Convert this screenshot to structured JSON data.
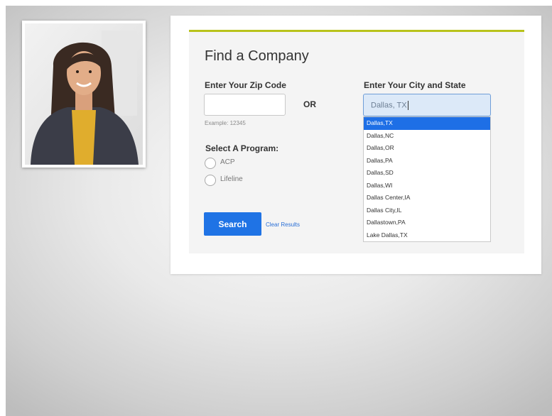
{
  "form": {
    "title": "Find a Company",
    "zip": {
      "label": "Enter Your Zip Code",
      "value": "",
      "hint": "Example: 12345"
    },
    "or_label": "OR",
    "city": {
      "label": "Enter Your City and State",
      "value": "Dallas, TX"
    },
    "suggestions": [
      {
        "label": "Dallas,TX",
        "selected": true
      },
      {
        "label": "Dallas,NC",
        "selected": false
      },
      {
        "label": "Dallas,OR",
        "selected": false
      },
      {
        "label": "Dallas,PA",
        "selected": false
      },
      {
        "label": "Dallas,SD",
        "selected": false
      },
      {
        "label": "Dallas,WI",
        "selected": false
      },
      {
        "label": "Dallas Center,IA",
        "selected": false
      },
      {
        "label": "Dallas City,IL",
        "selected": false
      },
      {
        "label": "Dallastown,PA",
        "selected": false
      },
      {
        "label": "Lake Dallas,TX",
        "selected": false
      }
    ],
    "program": {
      "label": "Select A Program:",
      "options": [
        {
          "label": "ACP",
          "checked": false
        },
        {
          "label": "Lifeline",
          "checked": false
        }
      ]
    },
    "search_label": "Search",
    "clear_label": "Clear Results"
  },
  "colors": {
    "accent_bar": "#b8c21b",
    "primary_button": "#1f73e5",
    "selected_suggestion": "#1e6fe6",
    "active_input_bg": "#dce9f8"
  }
}
